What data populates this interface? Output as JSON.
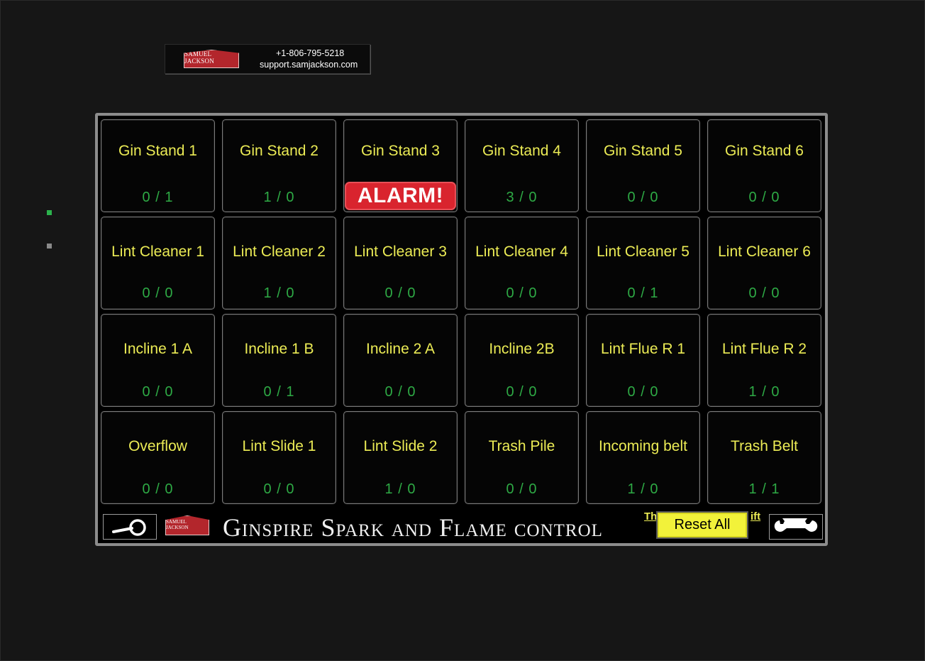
{
  "support": {
    "logo_text": "SAMUEL JACKSON",
    "phone": "+1-806-795-5218",
    "website": "support.samjackson.com"
  },
  "panel": {
    "title": "Ginspire Spark and Flame control",
    "logo_text": "SAMUEL JACKSON",
    "hidden_text_left": "Th",
    "hidden_text_right": "ift",
    "reset_label": "Reset All",
    "colors": {
      "name": "#ecec55",
      "count": "#2eaa45",
      "alarm": "#d9242e",
      "reset": "#f2f23a"
    },
    "rows": [
      [
        {
          "name": "Gin Stand 1",
          "count": "0 / 1"
        },
        {
          "name": "Gin Stand 2",
          "count": "1 / 0"
        },
        {
          "name": "Gin Stand 3",
          "alarm": "ALARM!"
        },
        {
          "name": "Gin Stand 4",
          "count": "3 / 0"
        },
        {
          "name": "Gin Stand 5",
          "count": "0 / 0"
        },
        {
          "name": "Gin Stand 6",
          "count": "0 / 0"
        }
      ],
      [
        {
          "name": "Lint Cleaner 1",
          "count": "0 / 0"
        },
        {
          "name": "Lint Cleaner 2",
          "count": "1 / 0"
        },
        {
          "name": "Lint Cleaner 3",
          "count": "0 / 0"
        },
        {
          "name": "Lint Cleaner 4",
          "count": "0 / 0"
        },
        {
          "name": "Lint Cleaner 5",
          "count": "0 / 1"
        },
        {
          "name": "Lint Cleaner 6",
          "count": "0 / 0"
        }
      ],
      [
        {
          "name": "Incline 1 A",
          "count": "0 / 0"
        },
        {
          "name": "Incline 1 B",
          "count": "0 / 1"
        },
        {
          "name": "Incline 2 A",
          "count": "0 / 0"
        },
        {
          "name": "Incline 2B",
          "count": "0 / 0"
        },
        {
          "name": "Lint Flue R 1",
          "count": "0 / 0"
        },
        {
          "name": "Lint Flue R 2",
          "count": "1 / 0"
        }
      ],
      [
        {
          "name": "Overflow",
          "count": "0 / 0"
        },
        {
          "name": "Lint Slide 1",
          "count": "0 / 0"
        },
        {
          "name": "Lint Slide 2",
          "count": "1 / 0"
        },
        {
          "name": "Trash Pile",
          "count": "0 / 0"
        },
        {
          "name": "Incoming belt",
          "count": "1 / 0"
        },
        {
          "name": "Trash Belt",
          "count": "1 / 1"
        }
      ]
    ]
  },
  "icons": {
    "search": "magnifier-icon",
    "settings": "wrench-icon"
  }
}
